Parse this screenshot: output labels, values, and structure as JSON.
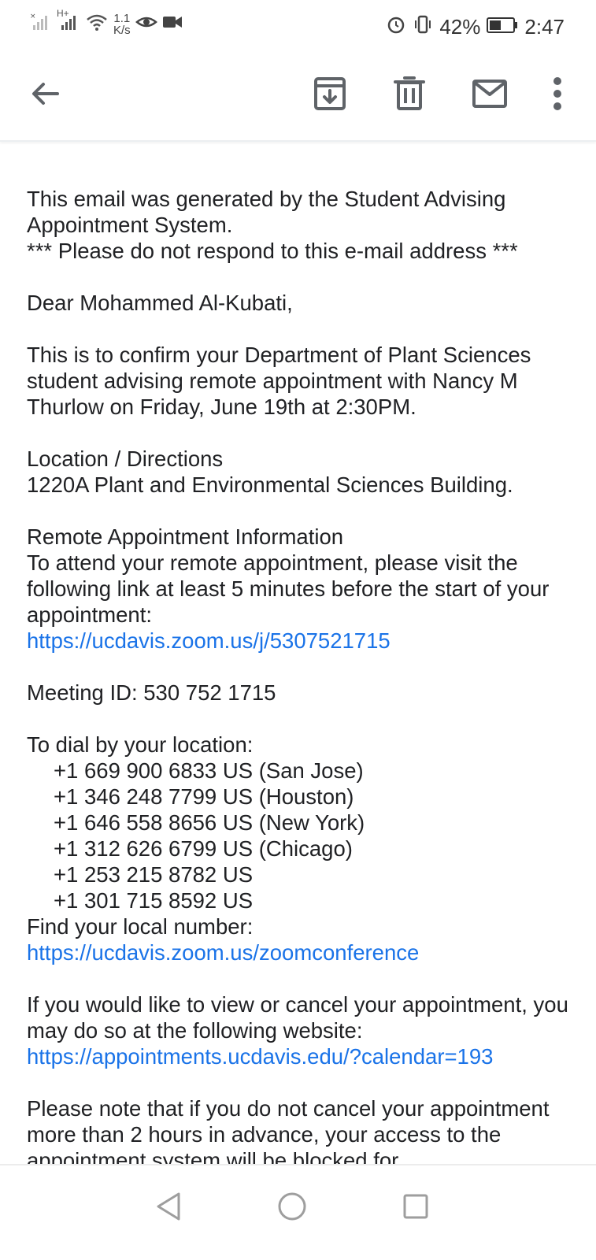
{
  "status_bar": {
    "net_type": "H+",
    "speed_value": "1.1",
    "speed_unit": "K/s",
    "battery_percent": "42%",
    "time": "2:47"
  },
  "toolbar": {
    "icons": [
      "back-arrow-icon",
      "archive-icon",
      "delete-icon",
      "mark-unread-icon",
      "more-options-icon"
    ]
  },
  "email": {
    "intro_line1": "This email was generated by the Student Advising Appointment System.",
    "intro_line2": "*** Please do not respond to this e-mail address ***",
    "greeting": "Dear Mohammed Al-Kubati,",
    "confirmation": "This is to confirm your Department of Plant Sciences student advising remote appointment with Nancy M Thurlow on Friday, June 19th at 2:30PM.",
    "location_heading": "Location / Directions",
    "location_value": "1220A Plant and Environmental Sciences Building.",
    "remote_heading": "Remote Appointment Information",
    "remote_instructions": "To attend your remote appointment, please visit the following link at least 5 minutes before the start of your appointment:",
    "zoom_link": "https://ucdavis.zoom.us/j/5307521715",
    "meeting_id": "Meeting ID: 530 752 1715",
    "dial_heading": "To dial by your location:",
    "dial_numbers": [
      "+1 669 900 6833 US (San Jose)",
      "+1 346 248 7799 US (Houston)",
      "+1 646 558 8656 US (New York)",
      "+1 312 626 6799 US (Chicago)",
      "+1 253 215 8782 US",
      "+1 301 715 8592 US"
    ],
    "local_number_label": "Find your local number:",
    "local_number_link": "https://ucdavis.zoom.us/zoomconference",
    "cancel_text": "If you would like to view or cancel your appointment, you may do so at the following website:",
    "cancel_link": "https://appointments.ucdavis.edu/?calendar=193",
    "note_text": "Please note that if you do not cancel your appointment more than 2 hours in advance, your access to the appointment system will be blocked for"
  },
  "colors": {
    "link": "#1a73e8",
    "text": "#202124",
    "icon": "#5f6368"
  }
}
